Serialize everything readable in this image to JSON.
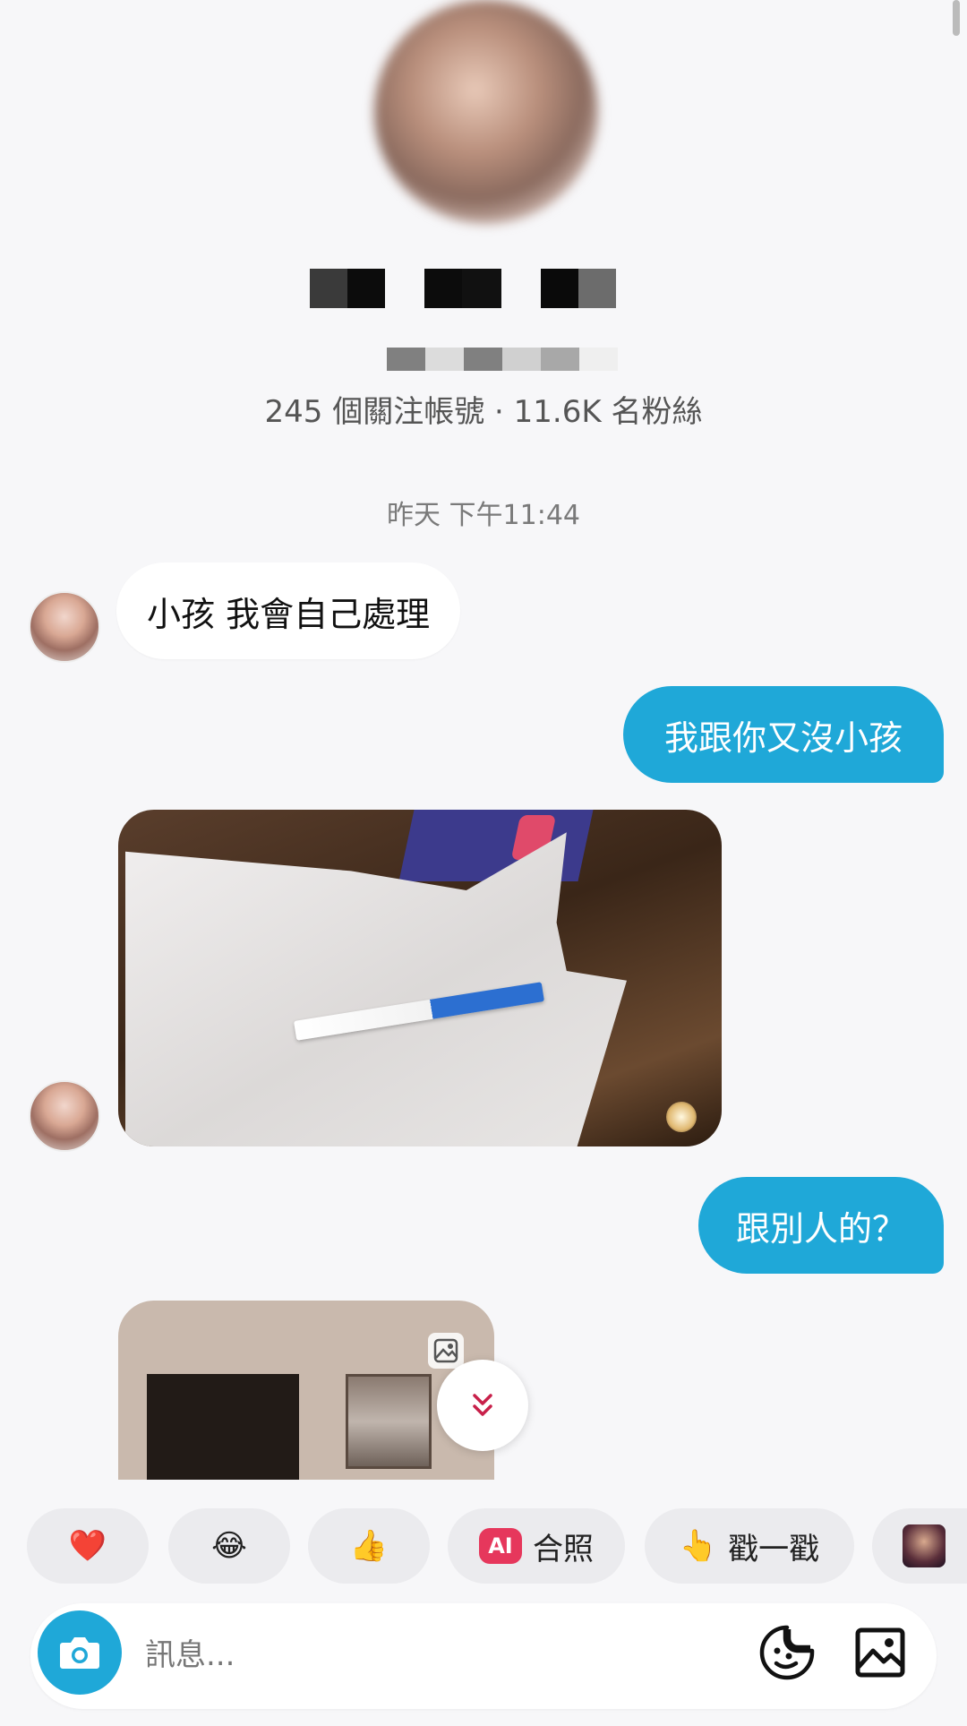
{
  "profile": {
    "stats": "245 個關注帳號 · 11.6K 名粉絲"
  },
  "chat": {
    "timestamp": "昨天 下午11:44",
    "messages": [
      {
        "from": "them",
        "type": "text",
        "text": "小孩 我會自己處理"
      },
      {
        "from": "me",
        "type": "text",
        "text": "我跟你又沒小孩"
      },
      {
        "from": "them",
        "type": "photo"
      },
      {
        "from": "me",
        "type": "text",
        "text": "跟別人的？"
      },
      {
        "from": "them",
        "type": "photo"
      }
    ]
  },
  "quick_replies": [
    {
      "icon": "heart-emoji",
      "label": "❤️"
    },
    {
      "icon": "tears-of-joy-emoji",
      "label": "😂"
    },
    {
      "icon": "thumbs-up-emoji",
      "label": "👍"
    },
    {
      "icon": "ai-badge",
      "badge": "AI",
      "label": "合照"
    },
    {
      "icon": "pointing-hand-emoji",
      "emoji": "👆",
      "label": "戳一戳"
    }
  ],
  "composer": {
    "placeholder": "訊息..."
  },
  "colors": {
    "outgoing_bubble": "#1fa8d8",
    "incoming_bubble": "#ffffff",
    "background": "#f7f7f9",
    "ai_badge": "#e6375c"
  }
}
